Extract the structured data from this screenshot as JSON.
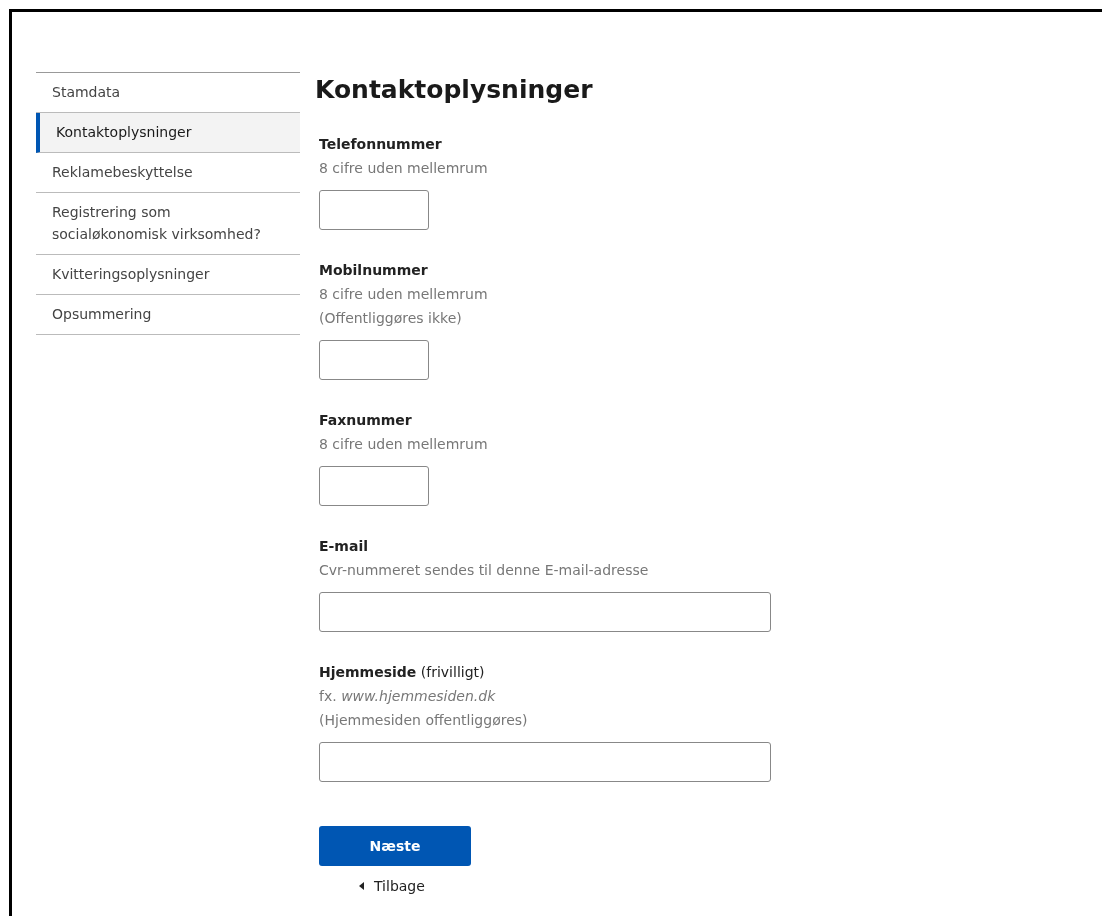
{
  "sidebar": {
    "items": [
      {
        "label": "Stamdata",
        "selected": false
      },
      {
        "label": "Kontaktoplysninger",
        "selected": true
      },
      {
        "label": "Reklamebeskyttelse",
        "selected": false
      },
      {
        "label": "Registrering som socialøkonomisk virksomhed?",
        "selected": false
      },
      {
        "label": "Kvitteringsoplysninger",
        "selected": false
      },
      {
        "label": "Opsummering",
        "selected": false
      }
    ]
  },
  "title": "Kontaktoplysninger",
  "fields": [
    {
      "label": "Telefonnummer",
      "hints": [
        "8 cifre uden mellemrum"
      ],
      "kind": "short"
    },
    {
      "label": "Mobilnummer",
      "hints": [
        "8 cifre uden mellemrum",
        "(Offentliggøres ikke)"
      ],
      "kind": "short"
    },
    {
      "label": "Faxnummer",
      "hints": [
        "8 cifre uden mellemrum"
      ],
      "kind": "short"
    },
    {
      "label": "E-mail",
      "hints": [
        "Cvr-nummeret sendes til denne E-mail-adresse"
      ],
      "kind": "long"
    },
    {
      "label": "Hjemmeside",
      "note": "(frivilligt)",
      "hints": [
        "fx. *www.hjemmesiden.dk*",
        "(Hjemmesiden offentliggøres)"
      ],
      "kind": "long"
    }
  ],
  "next_button": "Næste",
  "back_link": "Tilbage"
}
